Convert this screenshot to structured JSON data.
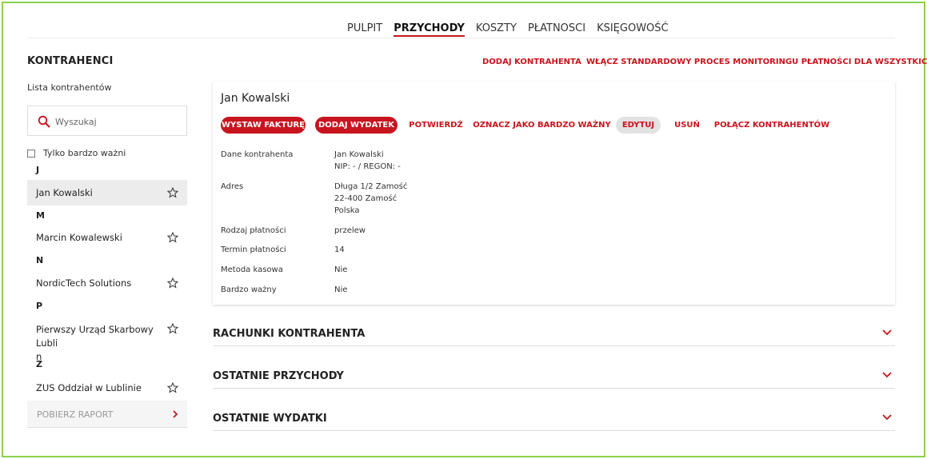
{
  "nav": {
    "tabs": [
      {
        "label": "PULPIT"
      },
      {
        "label": "PRZYCHODY"
      },
      {
        "label": "KOSZTY"
      },
      {
        "label": "PŁATNOSCI"
      },
      {
        "label": "KSIĘGOWOŚĆ"
      }
    ],
    "active_tab": "PRZYCHODY"
  },
  "sidebar": {
    "title": "KONTRAHENCI",
    "subtitle": "Lista kontrahentów",
    "search_placeholder": "Wyszukaj",
    "filter_label": "Tylko bardzo ważni",
    "groups": [
      {
        "letter": "J",
        "items": [
          {
            "name": "Jan Kowalski",
            "selected": true
          }
        ]
      },
      {
        "letter": "M",
        "items": [
          {
            "name": "Marcin Kowalewski"
          }
        ]
      },
      {
        "letter": "N",
        "items": [
          {
            "name": "NordicTech Solutions"
          }
        ]
      },
      {
        "letter": "P",
        "items": [
          {
            "name_line1": "Pierwszy Urząd Skarbowy Lubli",
            "name_line2": "n"
          }
        ]
      },
      {
        "letter": "Z",
        "items": [
          {
            "name": "ZUS Oddział w Lublinie"
          }
        ]
      }
    ],
    "report_label": "POBIERZ RAPORT"
  },
  "top_actions": {
    "add_contractor": "DODAJ KONTRAHENTA",
    "enable_monitoring": "WŁĄCZ STANDARDOWY PROCES MONITORINGU PŁATNOŚCI DLA WSZYSTKICH"
  },
  "card": {
    "title": "Jan Kowalski",
    "buttons": {
      "invoice": "WYSTAW FAKTURĘ",
      "expense": "DODAJ WYDATEK",
      "confirm": "POTWIERDŹ",
      "mark_important": "OZNACZ JAKO BARDZO WAŻNY",
      "edit": "EDYTUJ",
      "delete": "USUŃ",
      "merge": "POŁĄCZ KONTRAHENTÓW"
    },
    "fields": {
      "data_label": "Dane kontrahenta",
      "data_name": "Jan Kowalski",
      "data_ids": "NIP: - / REGON: -",
      "address_label": "Adres",
      "address_line1": "Długa 1/2 Zamość",
      "address_line2": "22-400 Zamość",
      "address_line3": "Polska",
      "payment_type_label": "Rodzaj płatności",
      "payment_type_value": "przelew",
      "payment_term_label": "Termin płatności",
      "payment_term_value": "14",
      "cash_method_label": "Metoda kasowa",
      "cash_method_value": "Nie",
      "very_important_label": "Bardzo ważny",
      "very_important_value": "Nie"
    }
  },
  "sections": {
    "accounts": "RACHUNKI KONTRAHENTA",
    "recent_income": "OSTATNIE PRZYCHODY",
    "recent_expenses": "OSTATNIE WYDATKI"
  },
  "colors": {
    "accent": "#c8141e",
    "frame": "#8bd14d",
    "selected_bg": "#ececec"
  }
}
